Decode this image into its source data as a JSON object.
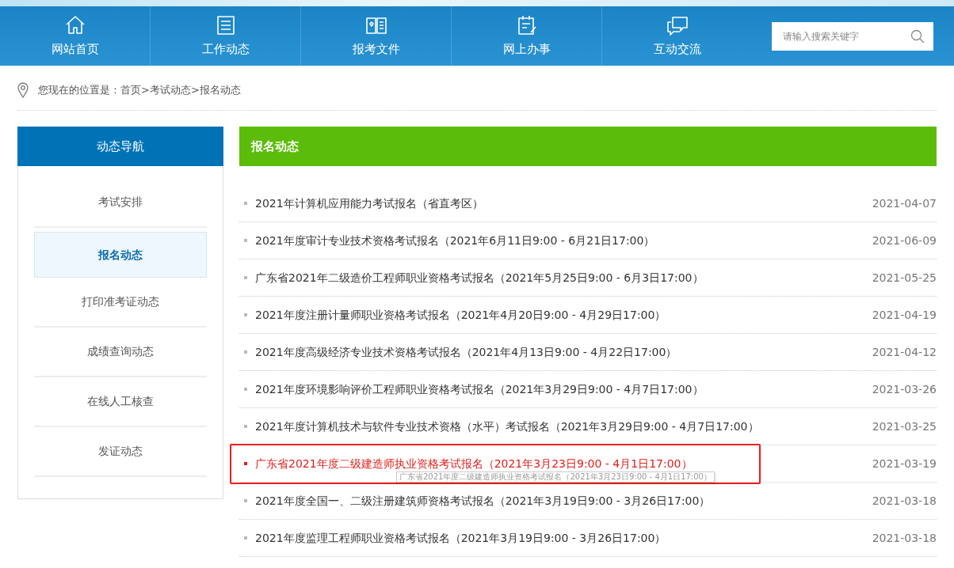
{
  "nav": [
    {
      "label": "网站首页"
    },
    {
      "label": "工作动态"
    },
    {
      "label": "报考文件"
    },
    {
      "label": "网上办事"
    },
    {
      "label": "互动交流"
    }
  ],
  "search": {
    "placeholder": "请输入搜索关键字"
  },
  "breadcrumb": {
    "prefix": "您现在的位置是：",
    "items": [
      "首页",
      "考试动态",
      "报名动态"
    ],
    "separator": ">"
  },
  "sidebar": {
    "title": "动态导航",
    "items": [
      {
        "label": "考试安排",
        "selected": false
      },
      {
        "label": "报名动态",
        "selected": true
      },
      {
        "label": "打印准考证动态",
        "selected": false
      },
      {
        "label": "成绩查询动态",
        "selected": false
      },
      {
        "label": "在线人工核查",
        "selected": false
      },
      {
        "label": "发证动态",
        "selected": false
      }
    ]
  },
  "content": {
    "title": "报名动态",
    "items": [
      {
        "title": "2021年计算机应用能力考试报名（省直考区）",
        "date": "2021-04-07",
        "hovered": false,
        "annotated": false
      },
      {
        "title": "2021年度审计专业技术资格考试报名（2021年6月11日9:00 - 6月21日17:00）",
        "date": "2021-06-09",
        "hovered": false,
        "annotated": false
      },
      {
        "title": "广东省2021年二级造价工程师职业资格考试报名（2021年5月25日9:00 - 6月3日17:00）",
        "date": "2021-05-25",
        "hovered": false,
        "annotated": false
      },
      {
        "title": "2021年度注册计量师职业资格考试报名（2021年4月20日9:00 - 4月29日17:00）",
        "date": "2021-04-19",
        "hovered": false,
        "annotated": false
      },
      {
        "title": "2021年度高级经济专业技术资格考试报名（2021年4月13日9:00 - 4月22日17:00）",
        "date": "2021-04-12",
        "hovered": false,
        "annotated": false
      },
      {
        "title": "2021年度环境影响评价工程师职业资格考试报名（2021年3月29日9:00 - 4月7日17:00）",
        "date": "2021-03-26",
        "hovered": false,
        "annotated": false
      },
      {
        "title": "2021年度计算机技术与软件专业技术资格（水平）考试报名（2021年3月29日9:00 - 4月7日17:00）",
        "date": "2021-03-25",
        "hovered": false,
        "annotated": false
      },
      {
        "title": "广东省2021年度二级建造师执业资格考试报名（2021年3月23日9:00 - 4月1日17:00）",
        "date": "2021-03-19",
        "hovered": true,
        "annotated": true
      },
      {
        "title": "2021年度全国一、二级注册建筑师资格考试报名（2021年3月19日9:00 - 3月26日17:00）",
        "date": "2021-03-18",
        "hovered": false,
        "annotated": false
      },
      {
        "title": "2021年度监理工程师职业资格考试报名（2021年3月19日9:00 - 3月26日17:00）",
        "date": "2021-03-18",
        "hovered": false,
        "annotated": false
      }
    ],
    "tooltip": "广东省2021年度二级建造师执业资格考试报名（2021年3月23日9:00 - 4月1日17:00）"
  }
}
